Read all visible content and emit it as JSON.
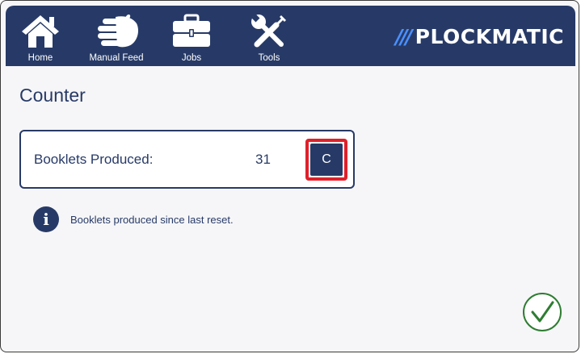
{
  "nav": {
    "items": [
      {
        "label": "Home",
        "icon": "home-icon"
      },
      {
        "label": "Manual Feed",
        "icon": "hand-icon"
      },
      {
        "label": "Jobs",
        "icon": "briefcase-icon"
      },
      {
        "label": "Tools",
        "icon": "tools-icon"
      }
    ]
  },
  "brand": {
    "slashes": "///",
    "name": "PLOCKMATIC"
  },
  "page": {
    "title": "Counter"
  },
  "counter": {
    "label": "Booklets Produced:",
    "value": "31",
    "clear_label": "C"
  },
  "info": {
    "text": "Booklets produced since last reset."
  },
  "colors": {
    "primary": "#273a67",
    "accent": "#4a90ff",
    "highlight": "#e0202a",
    "confirm": "#2e7d32"
  }
}
